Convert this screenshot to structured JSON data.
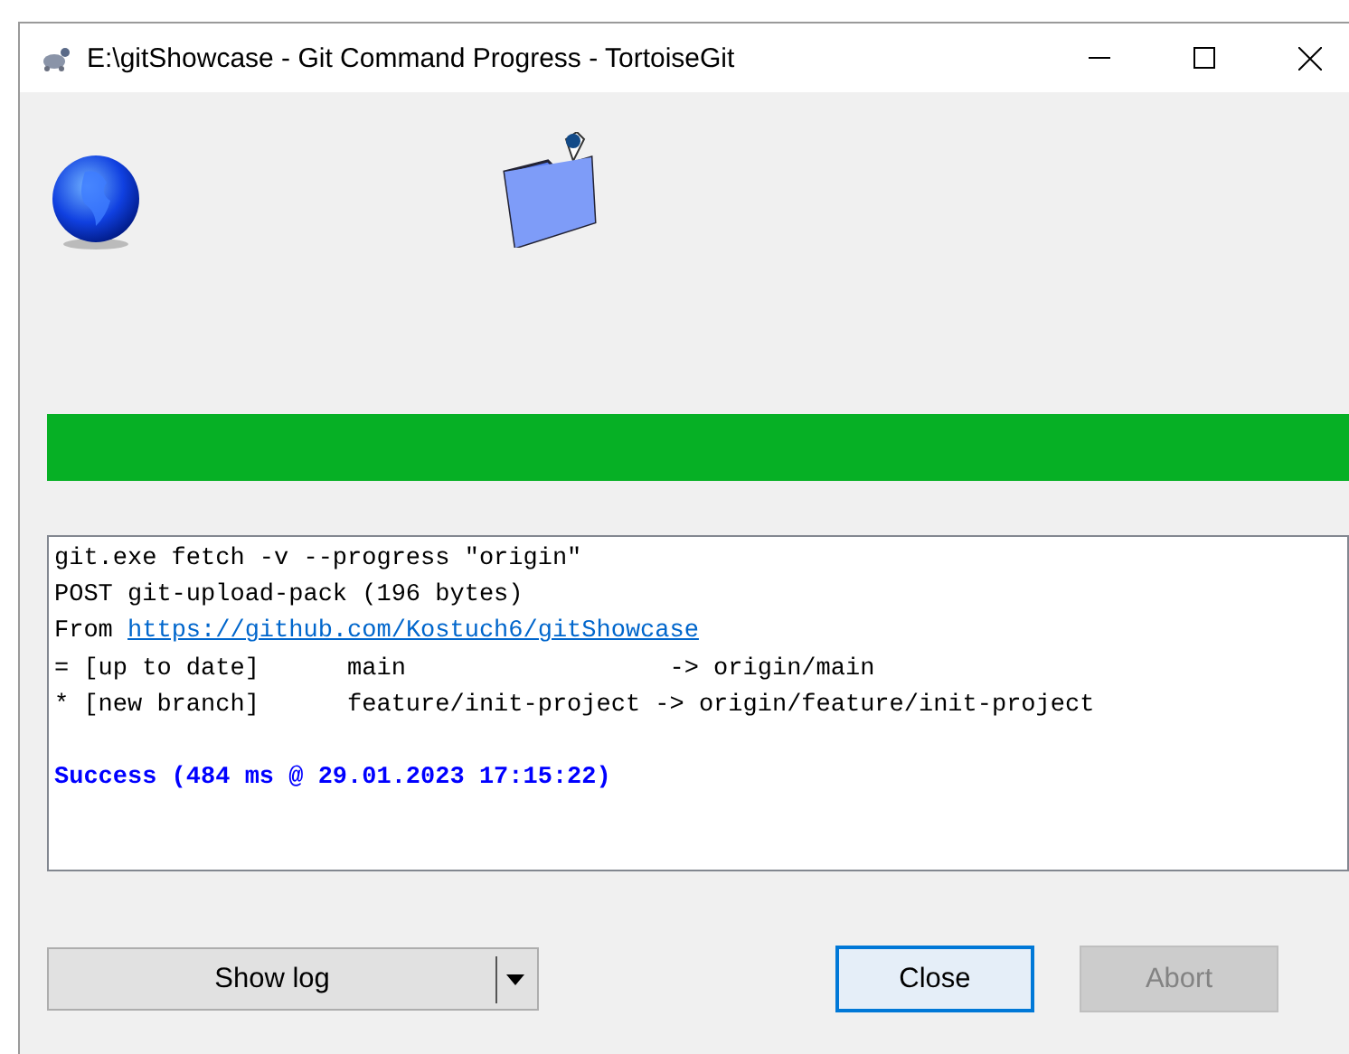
{
  "window": {
    "title": "E:\\gitShowcase - Git Command Progress - TortoiseGit"
  },
  "progress": {
    "level": 1
  },
  "log": [
    {
      "kind": "plain",
      "text": "git.exe fetch -v --progress \"origin\""
    },
    {
      "kind": "plain",
      "text": "POST git-upload-pack (196 bytes)"
    },
    {
      "kind": "link",
      "text": "From ",
      "url": "https://github.com/Kostuch6/gitShowcase"
    },
    {
      "kind": "plain",
      "text": "= [up to date]      main                  -> origin/main"
    },
    {
      "kind": "plain",
      "text": "* [new branch]      feature/init-project -> origin/feature/init-project"
    },
    {
      "kind": "blank"
    },
    {
      "kind": "success",
      "text": "Success (484 ms @ 29.01.2023 17:15:22)"
    }
  ],
  "buttons": [
    {
      "kind": "split",
      "label": "Show log"
    },
    {
      "kind": "push",
      "label": "Close",
      "disabled": false,
      "default": true
    },
    {
      "kind": "push",
      "label": "Abort",
      "disabled": true
    }
  ]
}
